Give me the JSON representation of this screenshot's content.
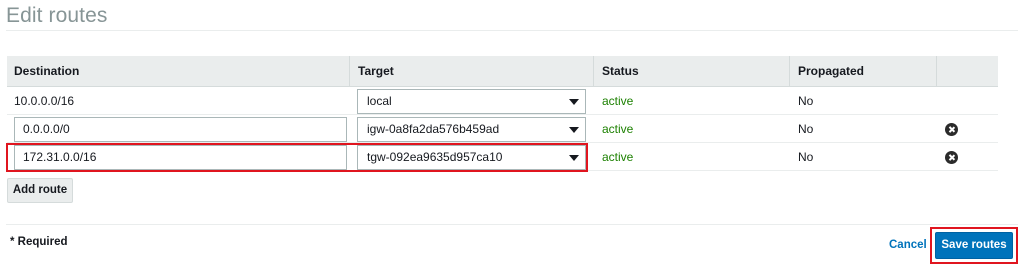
{
  "page": {
    "title": "Edit routes"
  },
  "table": {
    "columns": [
      "Destination",
      "Target",
      "Status",
      "Propagated"
    ],
    "rows": [
      {
        "destination": "10.0.0.0/16",
        "target": "local",
        "status": "active",
        "propagated": "No",
        "editable": false
      },
      {
        "destination": "0.0.0.0/0",
        "target": "igw-0a8fa2da576b459ad",
        "status": "active",
        "propagated": "No",
        "editable": true
      },
      {
        "destination": "172.31.0.0/16",
        "target": "tgw-092ea9635d957ca10",
        "status": "active",
        "propagated": "No",
        "editable": true
      }
    ],
    "status_color": "#1d8102"
  },
  "buttons": {
    "add_route": "Add route",
    "cancel": "Cancel",
    "save": "Save routes"
  },
  "footer": {
    "required": "* Required"
  },
  "colors": {
    "primary": "#0073bb",
    "highlight": "#e0151f"
  },
  "icons": {
    "remove": "remove-circle-icon",
    "dropdown": "caret-down-icon"
  }
}
